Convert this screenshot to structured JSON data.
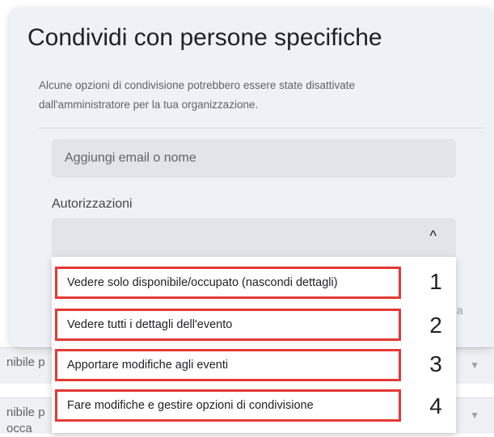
{
  "background": {
    "rows": [
      {
        "text": "nibile p"
      },
      {
        "text": "nibile p\nocca"
      }
    ]
  },
  "dialog": {
    "title": "Condividi con persone specifiche",
    "note": "Alcune opzioni di condivisione potrebbero essere state disattivate dall'amministratore per la tua organizzazione.",
    "email_placeholder": "Aggiungi email o nome",
    "permissions_label": "Autorizzazioni",
    "caret": "^",
    "cut_letter": "a"
  },
  "menu": {
    "options": [
      {
        "label": "Vedere solo disponibile/occupato (nascondi dettagli)",
        "number": "1"
      },
      {
        "label": "Vedere tutti i dettagli dell'evento",
        "number": "2"
      },
      {
        "label": "Apportare modifiche agli eventi",
        "number": "3"
      },
      {
        "label": "Fare modifiche e gestire opzioni di condivisione",
        "number": "4"
      }
    ]
  },
  "colors": {
    "dialog_bg": "#eef1f6",
    "highlight": "#e53935"
  }
}
